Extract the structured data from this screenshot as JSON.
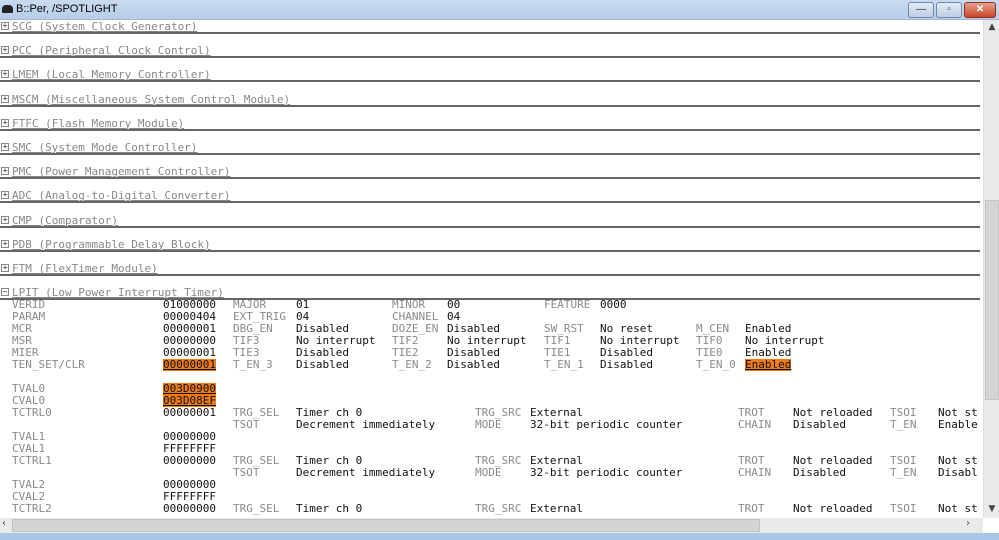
{
  "window": {
    "title": "B::Per, /SPOTLIGHT",
    "minimize": "—",
    "maximize": "▫",
    "close": "✕"
  },
  "sections": [
    {
      "label": "SCG (System Clock Generator)",
      "expanded": false
    },
    {
      "label": "PCC (Peripheral Clock Control)",
      "expanded": false
    },
    {
      "label": "LMEM (Local Memory Controller)",
      "expanded": false
    },
    {
      "label": "MSCM (Miscellaneous System Control Module)",
      "expanded": false
    },
    {
      "label": "FTFC (Flash Memory Module)",
      "expanded": false
    },
    {
      "label": "SMC (System Mode Controller)",
      "expanded": false
    },
    {
      "label": "PMC (Power Management Controller)",
      "expanded": false
    },
    {
      "label": "ADC (Analog-to-Digital Converter)",
      "expanded": false
    },
    {
      "label": "CMP (Comparator)",
      "expanded": false
    },
    {
      "label": "PDB (Programmable Delay Block)",
      "expanded": false
    },
    {
      "label": "FTM (FlexTimer Module)",
      "expanded": false
    },
    {
      "label": "LPIT (Low Power Interrupt Timer)",
      "expanded": true
    }
  ],
  "registers": [
    {
      "name": "VERID",
      "value": "01000000",
      "fields": [
        [
          "MAJOR",
          "01"
        ],
        [
          "MINOR",
          "00"
        ],
        [
          "FEATURE",
          "0000"
        ]
      ]
    },
    {
      "name": "PARAM",
      "value": "00000404",
      "fields": [
        [
          "EXT_TRIG",
          "04"
        ],
        [
          "CHANNEL",
          "04"
        ]
      ]
    },
    {
      "name": "MCR",
      "value": "00000001",
      "fields": [
        [
          "DBG_EN",
          "Disabled"
        ],
        [
          "DOZE_EN",
          "Disabled"
        ],
        [
          "SW_RST",
          "No reset"
        ],
        [
          "M_CEN",
          "Enabled"
        ]
      ]
    },
    {
      "name": "MSR",
      "value": "00000000",
      "fields": [
        [
          "TIF3",
          "No interrupt"
        ],
        [
          "TIF2",
          "No interrupt"
        ],
        [
          "TIF1",
          "No interrupt"
        ],
        [
          "TIF0",
          "No interrupt"
        ]
      ]
    },
    {
      "name": "MIER",
      "value": "00000001",
      "fields": [
        [
          "TIE3",
          "Disabled"
        ],
        [
          "TIE2",
          "Disabled"
        ],
        [
          "TIE1",
          "Disabled"
        ],
        [
          "TIE0",
          "Enabled"
        ]
      ]
    },
    {
      "name": "TEN_SET/CLR",
      "value": "00000001",
      "highlight": true,
      "fields": [
        [
          "T_EN_3",
          "Disabled"
        ],
        [
          "T_EN_2",
          "Disabled"
        ],
        [
          "T_EN_1",
          "Disabled"
        ],
        [
          "T_EN_0",
          "Enabled",
          true
        ]
      ]
    }
  ],
  "channels": [
    {
      "tval": [
        "TVAL0",
        "003D0900",
        true
      ],
      "cval": [
        "CVAL0",
        "003D08EF",
        true
      ],
      "tctrl": [
        "TCTRL0",
        "00000001"
      ],
      "line1": [
        [
          "TRG_SEL",
          "Timer ch 0"
        ],
        [
          "TRG_SRC",
          "External"
        ],
        [
          "TROT",
          "Not reloaded"
        ],
        [
          "TSOI",
          "Not st"
        ]
      ],
      "line2": [
        [
          "TSOT",
          "Decrement immediately"
        ],
        [
          "MODE",
          "32-bit periodic counter"
        ],
        [
          "CHAIN",
          "Disabled"
        ],
        [
          "T_EN",
          "Enable"
        ]
      ]
    },
    {
      "tval": [
        "TVAL1",
        "00000000"
      ],
      "cval": [
        "CVAL1",
        "FFFFFFFF"
      ],
      "tctrl": [
        "TCTRL1",
        "00000000"
      ],
      "line1": [
        [
          "TRG_SEL",
          "Timer ch 0"
        ],
        [
          "TRG_SRC",
          "External"
        ],
        [
          "TROT",
          "Not reloaded"
        ],
        [
          "TSOI",
          "Not st"
        ]
      ],
      "line2": [
        [
          "TSOT",
          "Decrement immediately"
        ],
        [
          "MODE",
          "32-bit periodic counter"
        ],
        [
          "CHAIN",
          "Disabled"
        ],
        [
          "T_EN",
          "Disabl"
        ]
      ]
    },
    {
      "tval": [
        "TVAL2",
        "00000000"
      ],
      "cval": [
        "CVAL2",
        "FFFFFFFF"
      ],
      "tctrl": [
        "TCTRL2",
        "00000000"
      ],
      "line1": [
        [
          "TRG_SEL",
          "Timer ch 0"
        ],
        [
          "TRG_SRC",
          "External"
        ],
        [
          "TROT",
          "Not reloaded"
        ],
        [
          "TSOI",
          "Not st"
        ]
      ]
    }
  ],
  "colors": {
    "highlight": "#f07a18"
  }
}
